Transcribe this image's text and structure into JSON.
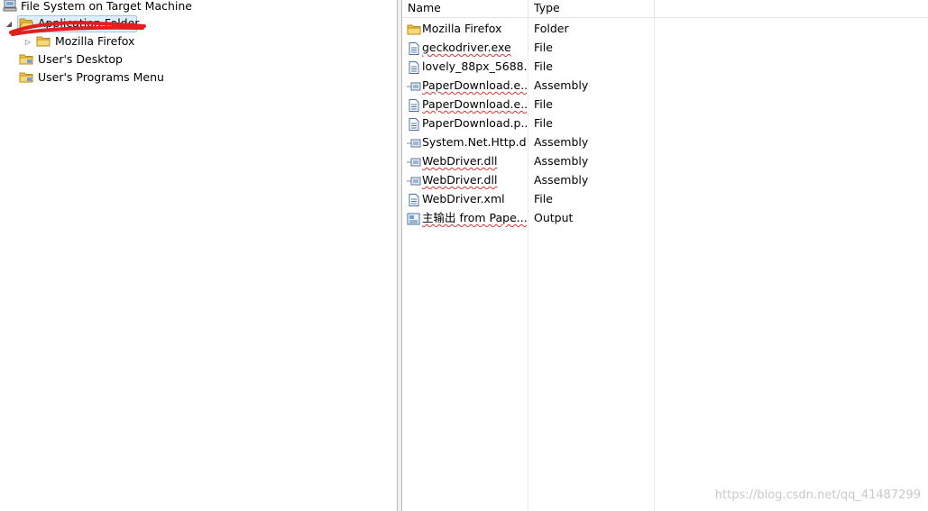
{
  "tree": {
    "root_label": "File System on Target Machine",
    "root_icon": "computer-icon",
    "items": [
      {
        "label": "Application Folder",
        "icon": "folder-open-icon",
        "expanded": true,
        "selected": true
      },
      {
        "label": "Mozilla Firefox",
        "icon": "folder-icon",
        "expanded": false
      },
      {
        "label": "User's Desktop",
        "icon": "folder-icon"
      },
      {
        "label": "User's Programs Menu",
        "icon": "folder-icon"
      }
    ],
    "expanded_glyph": "◢",
    "collapsed_glyph": "▷"
  },
  "list": {
    "columns": [
      "Name",
      "Type"
    ],
    "rows": [
      {
        "name": "Mozilla Firefox",
        "type": "Folder",
        "icon": "folder-icon"
      },
      {
        "name": "geckodriver.exe",
        "type": "File",
        "icon": "file-icon"
      },
      {
        "name": "lovely_88px_5688...",
        "type": "File",
        "icon": "file-icon"
      },
      {
        "name": "PaperDownload.e...",
        "type": "Assembly",
        "icon": "assembly-icon"
      },
      {
        "name": "PaperDownload.e...",
        "type": "File",
        "icon": "file-icon"
      },
      {
        "name": "PaperDownload.p...",
        "type": "File",
        "icon": "file-icon"
      },
      {
        "name": "System.Net.Http.dll",
        "type": "Assembly",
        "icon": "assembly-icon"
      },
      {
        "name": "WebDriver.dll",
        "type": "Assembly",
        "icon": "assembly-icon"
      },
      {
        "name": "WebDriver.dll",
        "type": "Assembly",
        "icon": "assembly-icon"
      },
      {
        "name": "WebDriver.xml",
        "type": "File",
        "icon": "file-icon"
      },
      {
        "name": "主输出 from Pape...",
        "type": "Output",
        "icon": "output-icon"
      }
    ]
  },
  "watermark": "https://blog.csdn.net/qq_41487299",
  "colors": {
    "selection_bg": "#dfeefc",
    "selection_border": "#9ec6ef",
    "annotation_red": "#e02020",
    "folder_yellow": "#f2c94c"
  }
}
